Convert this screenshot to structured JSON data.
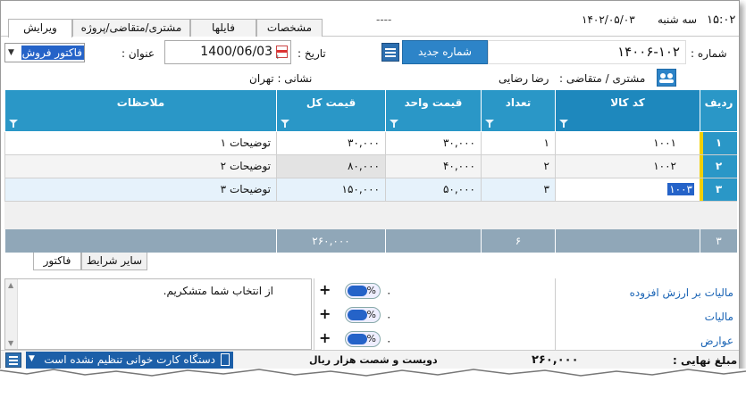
{
  "topbar": {
    "time": "۱۵:۰۲",
    "day": "سه شنبه",
    "date": "۱۴۰۲/۰۵/۰۳",
    "placeholder": "----",
    "tabs": [
      {
        "label": "ویرایش",
        "active": true
      },
      {
        "label": "مشتری/متقاضی/پروژه",
        "active": false
      },
      {
        "label": "فایلها",
        "active": false
      },
      {
        "label": "مشخصات",
        "active": false
      }
    ]
  },
  "form": {
    "number_label": "شماره :",
    "number_value": "۱۴۰۰۶-۱۰۲",
    "new_number_button": "شماره جدید",
    "date_label": "تاریخ :",
    "date_value": "1400/06/03",
    "title_label": "عنوان :",
    "title_value": "فاکتور فروش",
    "customer_label": "مشتری / متقاضی :",
    "customer_value": "رضا رضایی",
    "address_label": "نشانی : تهران"
  },
  "grid": {
    "headers": {
      "row": "ردیف",
      "code": "کد کالا",
      "qty": "تعداد",
      "unit_price": "قیمت واحد",
      "total": "قیمت کل",
      "notes": "ملاحظات"
    },
    "rows": [
      {
        "rn": "۱",
        "code": "۱۰۰۱",
        "qty": "۱",
        "unit_price": "۳۰,۰۰۰",
        "total": "۳۰,۰۰۰",
        "notes": "توضیحات ۱"
      },
      {
        "rn": "۲",
        "code": "۱۰۰۲",
        "qty": "۲",
        "unit_price": "۴۰,۰۰۰",
        "total": "۸۰,۰۰۰",
        "notes": "توضیحات ۲"
      },
      {
        "rn": "۳",
        "code": "۱۰۰۳",
        "qty": "۳",
        "unit_price": "۵۰,۰۰۰",
        "total": "۱۵۰,۰۰۰",
        "notes": "توضیحات ۳"
      }
    ],
    "footer": {
      "count": "۳",
      "qty_sum": "۶",
      "total_sum": "۲۶۰,۰۰۰"
    }
  },
  "bottom_tabs": [
    {
      "label": "فاکتور",
      "active": true
    },
    {
      "label": "سایر شرایط",
      "active": false
    }
  ],
  "taxes": {
    "items": [
      {
        "label": "مالیات بر ارزش افزوده",
        "value": "۰",
        "unit": "%"
      },
      {
        "label": "مالیات",
        "value": "۰",
        "unit": "%"
      },
      {
        "label": "عوارض",
        "value": "۰",
        "unit": "%"
      }
    ],
    "plus_symbol": "+"
  },
  "notes_text": "از انتخاب شما متشکریم.",
  "statusbar": {
    "final_label": "مبلغ نهایی :",
    "final_value": "۲۶۰,۰۰۰",
    "words": "دویست و شصت  هزار  ریال",
    "card_reader": "دستگاه کارت خوانی تنظیم نشده است"
  },
  "colors": {
    "header_blue": "#2a97c7",
    "button_blue": "#2d84c8",
    "footer_gray": "#90a7b8",
    "selected_row": "#e6f2fb",
    "marker_yellow": "#f2d000"
  }
}
